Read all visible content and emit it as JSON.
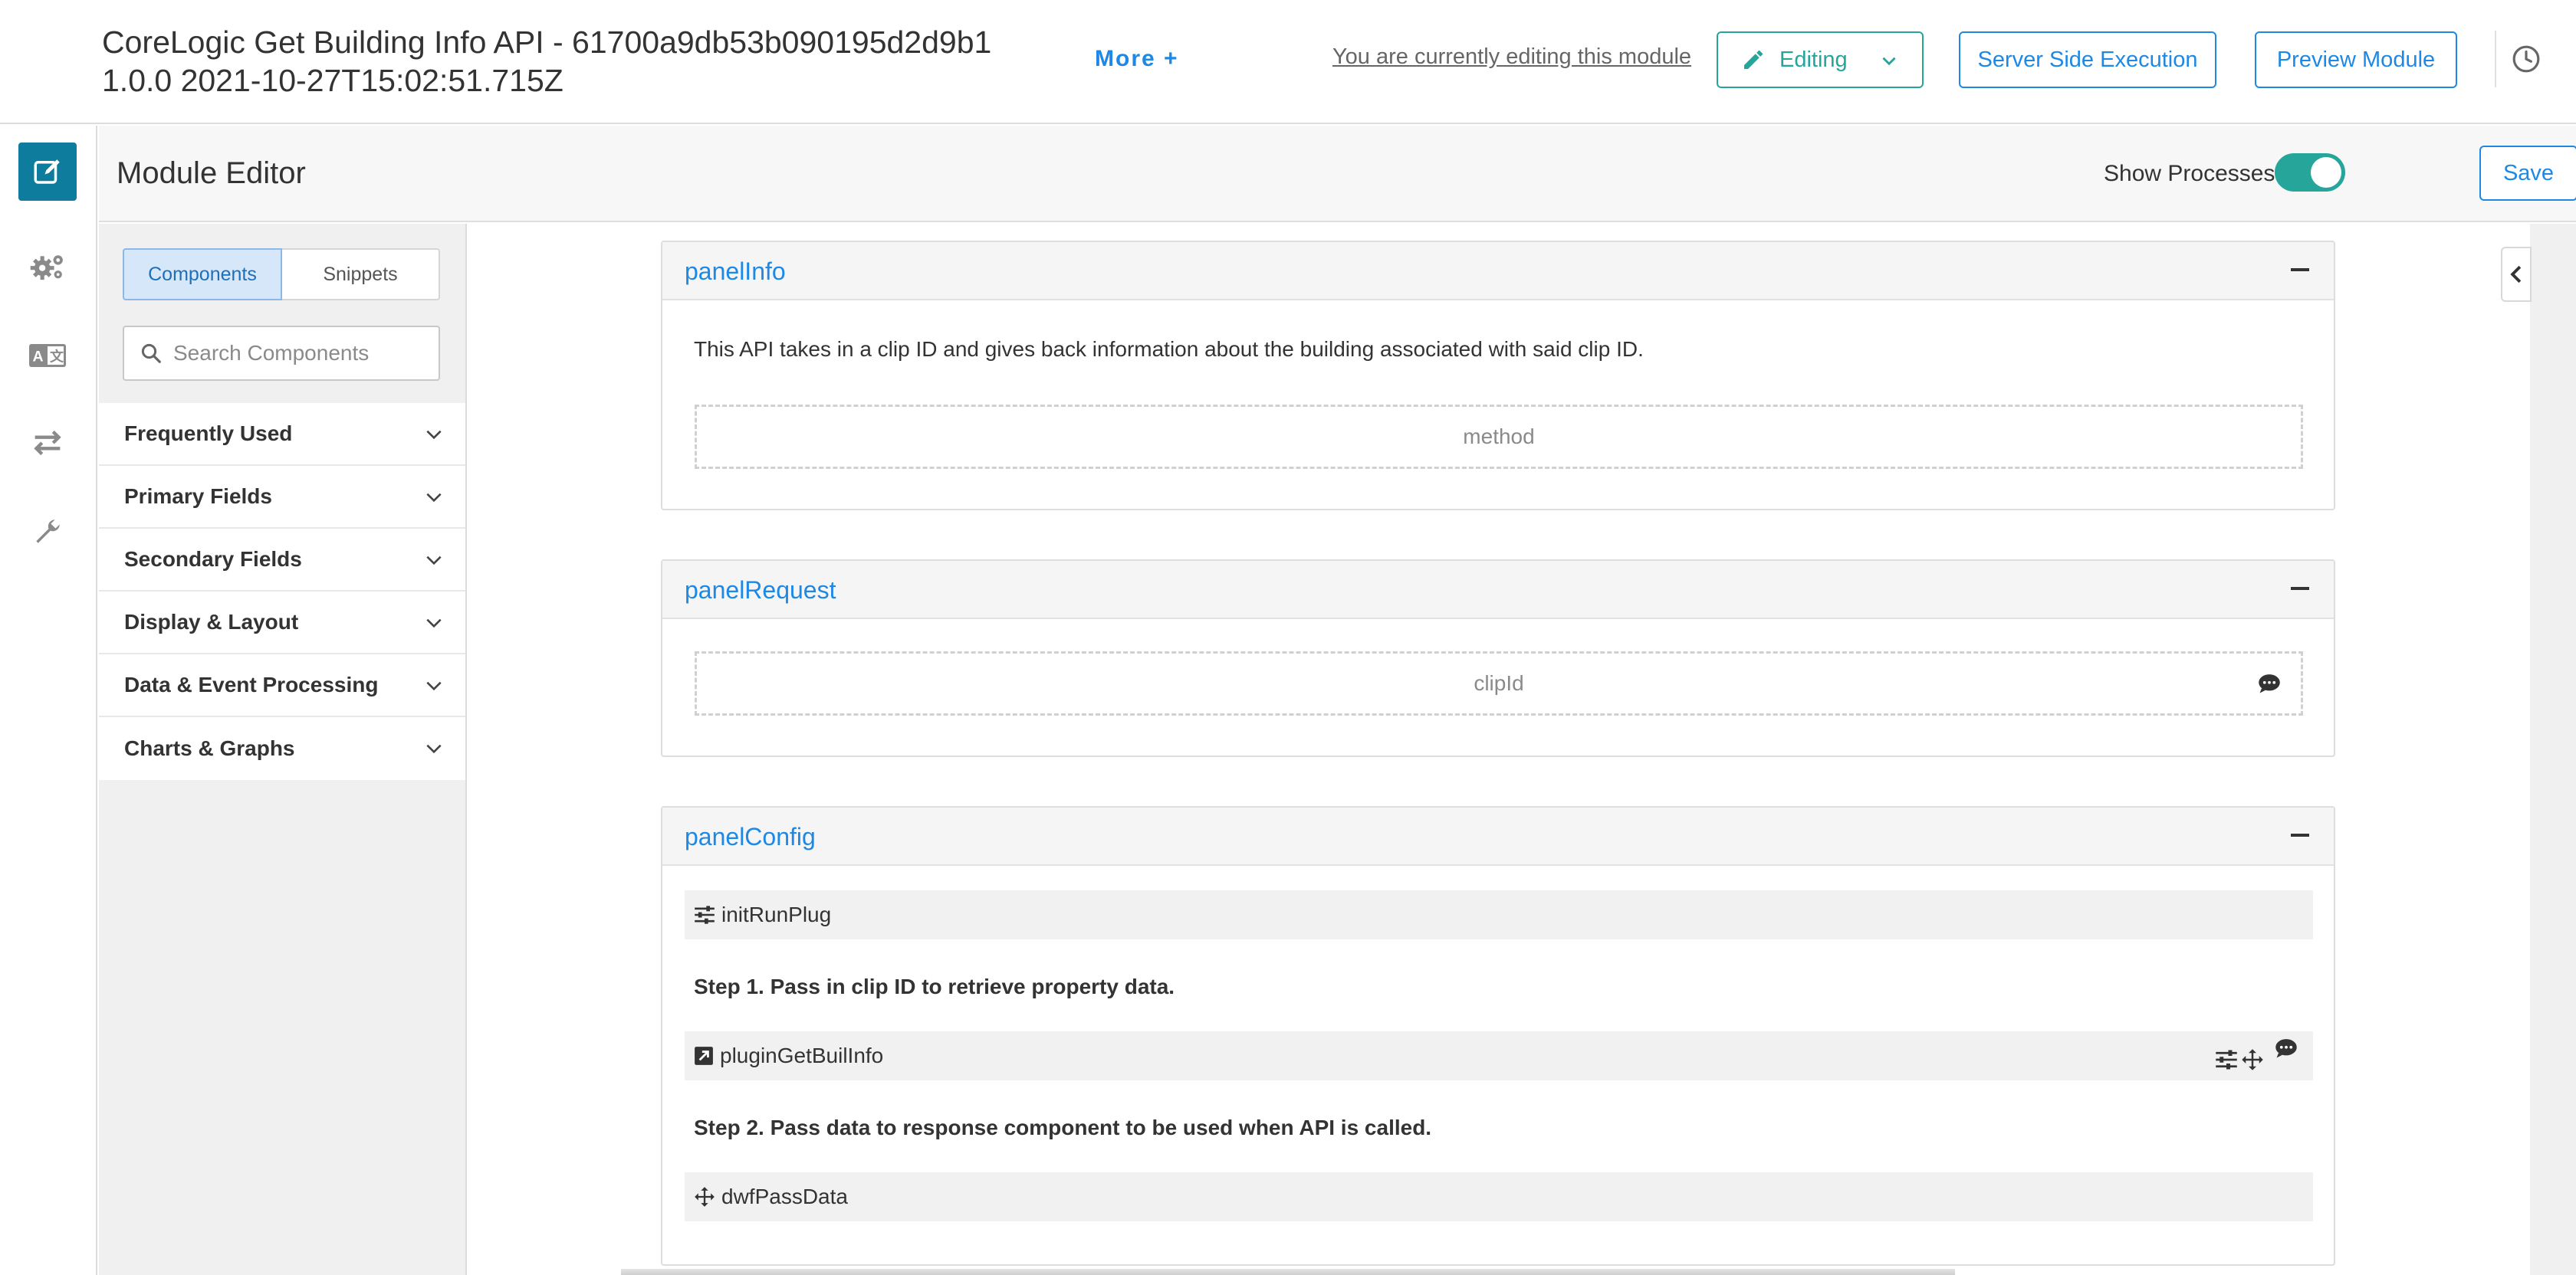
{
  "header": {
    "title": "CoreLogic Get Building Info API - 61700a9db53b090195d2d9b1 1.0.0 2021-10-27T15:02:51.715Z",
    "more_label": "More +",
    "edit_notice": "You are currently editing this module",
    "editing_label": "Editing",
    "server_side_label": "Server Side Execution",
    "preview_label": "Preview Module",
    "history_icon": "clock-icon"
  },
  "rail": {
    "items": [
      {
        "icon": "edit-icon",
        "active": true
      },
      {
        "icon": "gears-icon",
        "active": false
      },
      {
        "icon": "translate-icon",
        "active": false
      },
      {
        "icon": "transfer-arrows-icon",
        "active": false
      },
      {
        "icon": "wrench-icon",
        "active": false
      }
    ]
  },
  "editor": {
    "title": "Module Editor",
    "show_processes_label": "Show Processes",
    "show_processes_on": true,
    "save_label": "Save",
    "more_icon": "ellipsis-icon"
  },
  "sidebar": {
    "tabs": [
      {
        "label": "Components",
        "active": true
      },
      {
        "label": "Snippets",
        "active": false
      }
    ],
    "search_placeholder": "Search Components",
    "categories": [
      {
        "label": "Frequently Used"
      },
      {
        "label": "Primary Fields"
      },
      {
        "label": "Secondary Fields"
      },
      {
        "label": "Display & Layout"
      },
      {
        "label": "Data & Event Processing"
      },
      {
        "label": "Charts & Graphs"
      }
    ]
  },
  "panels": {
    "info": {
      "title": "panelInfo",
      "description": "This API takes in a clip ID and gives back information about the building associated with said clip ID.",
      "field": "method"
    },
    "request": {
      "title": "panelRequest",
      "field": "clipId"
    },
    "config": {
      "title": "panelConfig",
      "init_plug": "initRunPlug",
      "step1": "Step 1. Pass in clip ID to retrieve property data.",
      "plugin": "pluginGetBuilInfo",
      "step2": "Step 2. Pass data to response component to be used when API is called.",
      "pass_data": "dwfPassData"
    }
  },
  "colors": {
    "accent_blue": "#1e88e5",
    "teal": "#26a69a",
    "rail_active": "#0e7c9c"
  }
}
